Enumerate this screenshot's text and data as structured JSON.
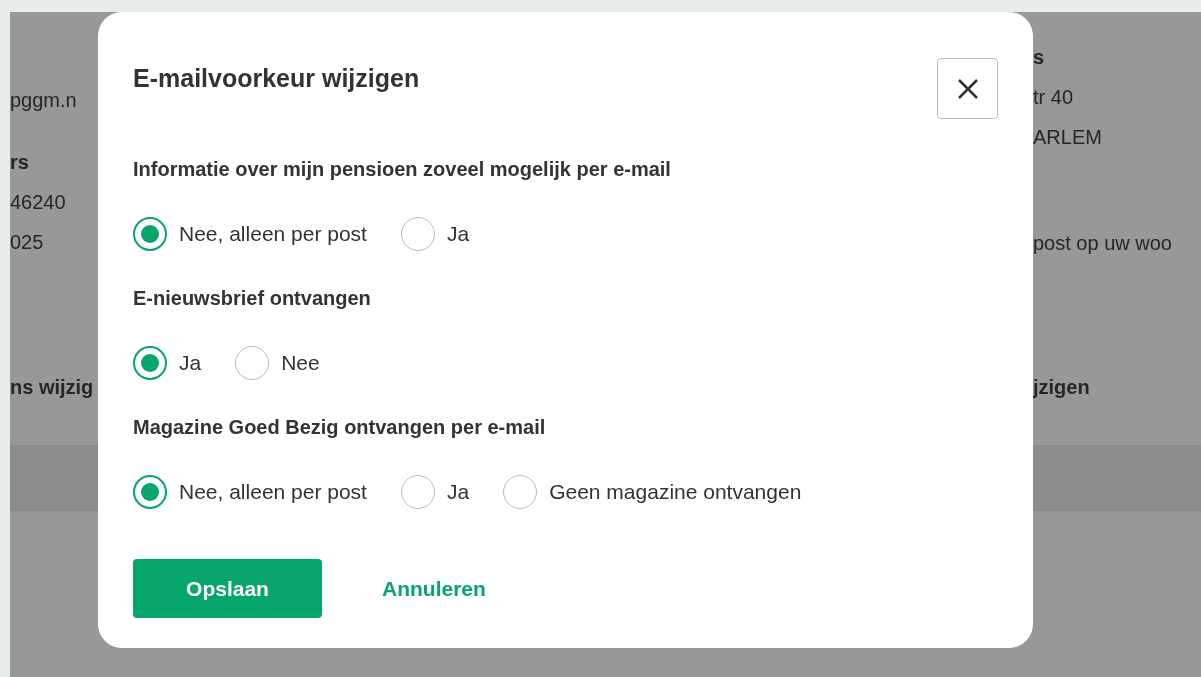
{
  "background": {
    "left_column": [
      {
        "lines": [
          {
            "text": "pggm.n",
            "bold": false
          }
        ]
      },
      {
        "lines": [
          {
            "text": "rs",
            "bold": true
          },
          {
            "text": "46240",
            "bold": false
          },
          {
            "text": "025",
            "bold": false
          }
        ]
      },
      {
        "lines": [
          {
            "text": "ns wijzig",
            "bold": true
          }
        ]
      }
    ],
    "right_column": [
      {
        "lines": [
          {
            "text": "s",
            "bold": true
          },
          {
            "text": "tr 40",
            "bold": false
          },
          {
            "text": "ARLEM",
            "bold": false
          }
        ]
      },
      {
        "lines": [
          {
            "text": "post op uw woo",
            "bold": false
          }
        ]
      },
      {
        "lines": [
          {
            "text": "jzigen",
            "bold": true
          }
        ]
      }
    ]
  },
  "dialog": {
    "title": "E-mailvoorkeur wijzigen",
    "groups": [
      {
        "label": "Informatie over mijn pensioen zoveel mogelijk per e-mail",
        "options": [
          {
            "label": "Nee, alleen per post",
            "selected": true
          },
          {
            "label": "Ja",
            "selected": false
          }
        ]
      },
      {
        "label": "E-nieuwsbrief ontvangen",
        "options": [
          {
            "label": "Ja",
            "selected": true
          },
          {
            "label": "Nee",
            "selected": false
          }
        ]
      },
      {
        "label": "Magazine Goed Bezig ontvangen per e-mail",
        "options": [
          {
            "label": "Nee, alleen per post",
            "selected": true
          },
          {
            "label": "Ja",
            "selected": false
          },
          {
            "label": "Geen magazine ontvangen",
            "selected": false
          }
        ]
      }
    ],
    "save_button": "Opslaan",
    "cancel_link": "Annuleren"
  }
}
